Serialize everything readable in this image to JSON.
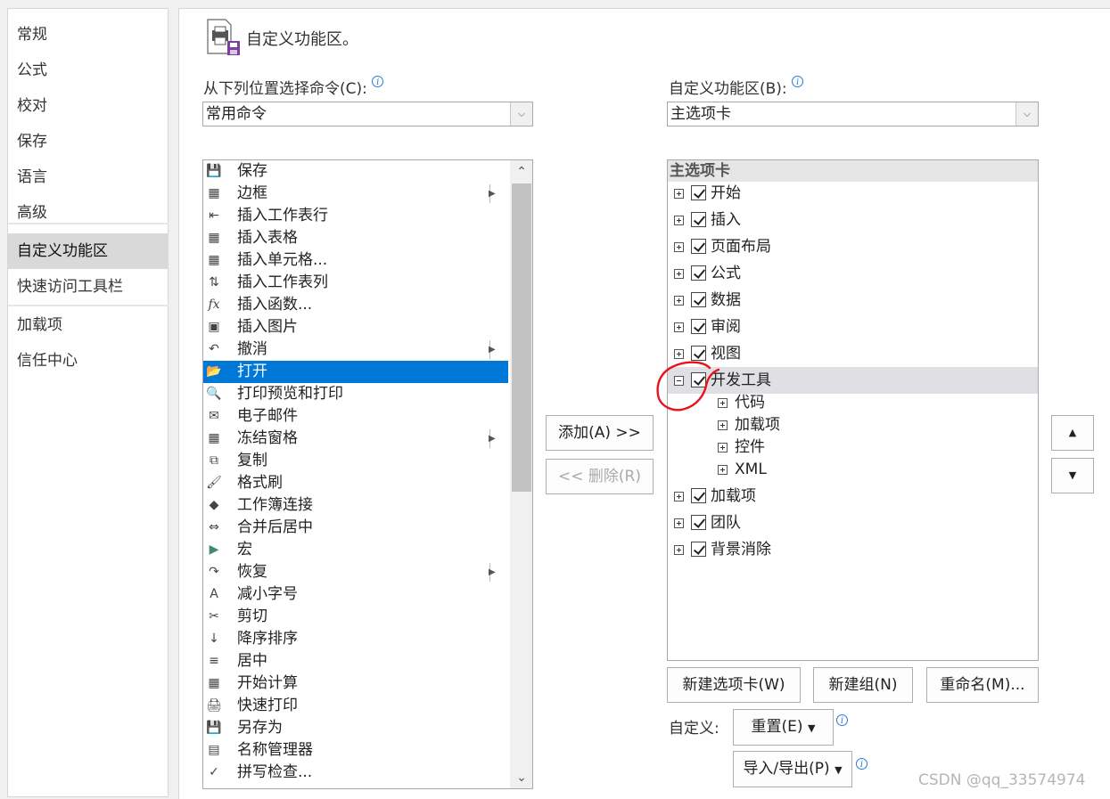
{
  "nav": {
    "items": [
      {
        "label": "常规"
      },
      {
        "label": "公式"
      },
      {
        "label": "校对"
      },
      {
        "label": "保存"
      },
      {
        "label": "语言"
      },
      {
        "label": "高级"
      },
      {
        "label": "自定义功能区"
      },
      {
        "label": "快速访问工具栏"
      },
      {
        "label": "加载项"
      },
      {
        "label": "信任中心"
      }
    ],
    "selected_index": 6
  },
  "header": {
    "title": "自定义功能区。",
    "icon": "ribbon-customize-icon"
  },
  "left_panel": {
    "label": "从下列位置选择命令(C):",
    "dropdown_value": "常用命令",
    "commands": [
      {
        "label": "保存",
        "icon": "save-icon"
      },
      {
        "label": "边框",
        "icon": "border-icon",
        "submenu": true
      },
      {
        "label": "插入工作表行",
        "icon": "insert-row-icon"
      },
      {
        "label": "插入表格",
        "icon": "insert-table-icon"
      },
      {
        "label": "插入单元格...",
        "icon": "insert-cell-icon"
      },
      {
        "label": "插入工作表列",
        "icon": "insert-column-icon"
      },
      {
        "label": "插入函数...",
        "icon": "function-icon"
      },
      {
        "label": "插入图片",
        "icon": "picture-icon"
      },
      {
        "label": "撤消",
        "icon": "undo-icon",
        "submenu": true
      },
      {
        "label": "打开",
        "icon": "folder-open-icon",
        "selected": true
      },
      {
        "label": "打印预览和打印",
        "icon": "print-preview-icon"
      },
      {
        "label": "电子邮件",
        "icon": "email-icon"
      },
      {
        "label": "冻结窗格",
        "icon": "freeze-panes-icon",
        "submenu": true
      },
      {
        "label": "复制",
        "icon": "copy-icon"
      },
      {
        "label": "格式刷",
        "icon": "format-painter-icon"
      },
      {
        "label": "工作簿连接",
        "icon": "connections-icon"
      },
      {
        "label": "合并后居中",
        "icon": "merge-center-icon"
      },
      {
        "label": "宏",
        "icon": "macro-icon"
      },
      {
        "label": "恢复",
        "icon": "redo-icon",
        "submenu": true
      },
      {
        "label": "减小字号",
        "icon": "decrease-font-icon"
      },
      {
        "label": "剪切",
        "icon": "cut-icon"
      },
      {
        "label": "降序排序",
        "icon": "sort-descending-icon"
      },
      {
        "label": "居中",
        "icon": "align-center-icon"
      },
      {
        "label": "开始计算",
        "icon": "calculator-icon"
      },
      {
        "label": "快速打印",
        "icon": "quick-print-icon"
      },
      {
        "label": "另存为",
        "icon": "save-as-icon"
      },
      {
        "label": "名称管理器",
        "icon": "name-manager-icon"
      },
      {
        "label": "拼写检查...",
        "icon": "spelling-icon"
      }
    ]
  },
  "middle": {
    "add_label": "添加(A) >>",
    "remove_label": "<< 删除(R)"
  },
  "right_panel": {
    "label": "自定义功能区(B):",
    "dropdown_value": "主选项卡",
    "tree_header": "主选项卡",
    "tabs": [
      {
        "label": "开始",
        "checked": true,
        "expanded": false
      },
      {
        "label": "插入",
        "checked": true,
        "expanded": false
      },
      {
        "label": "页面布局",
        "checked": true,
        "expanded": false
      },
      {
        "label": "公式",
        "checked": true,
        "expanded": false
      },
      {
        "label": "数据",
        "checked": true,
        "expanded": false
      },
      {
        "label": "审阅",
        "checked": true,
        "expanded": false
      },
      {
        "label": "视图",
        "checked": true,
        "expanded": false
      },
      {
        "label": "开发工具",
        "checked": true,
        "expanded": true,
        "highlighted": true,
        "groups": [
          {
            "label": "代码"
          },
          {
            "label": "加载项"
          },
          {
            "label": "控件"
          },
          {
            "label": "XML"
          }
        ]
      },
      {
        "label": "加载项",
        "checked": true,
        "expanded": false
      },
      {
        "label": "团队",
        "checked": true,
        "expanded": false
      },
      {
        "label": "背景消除",
        "checked": true,
        "expanded": false
      }
    ],
    "new_tab_label": "新建选项卡(W)",
    "new_group_label": "新建组(N)",
    "rename_label": "重命名(M)...",
    "customize_label": "自定义:",
    "reset_label": "重置(E)",
    "import_export_label": "导入/导出(P)"
  },
  "watermark": "CSDN @qq_33574974",
  "colors": {
    "selection": "#0078d7",
    "annotation": "#e8141b",
    "info": "#2a7bd6"
  }
}
